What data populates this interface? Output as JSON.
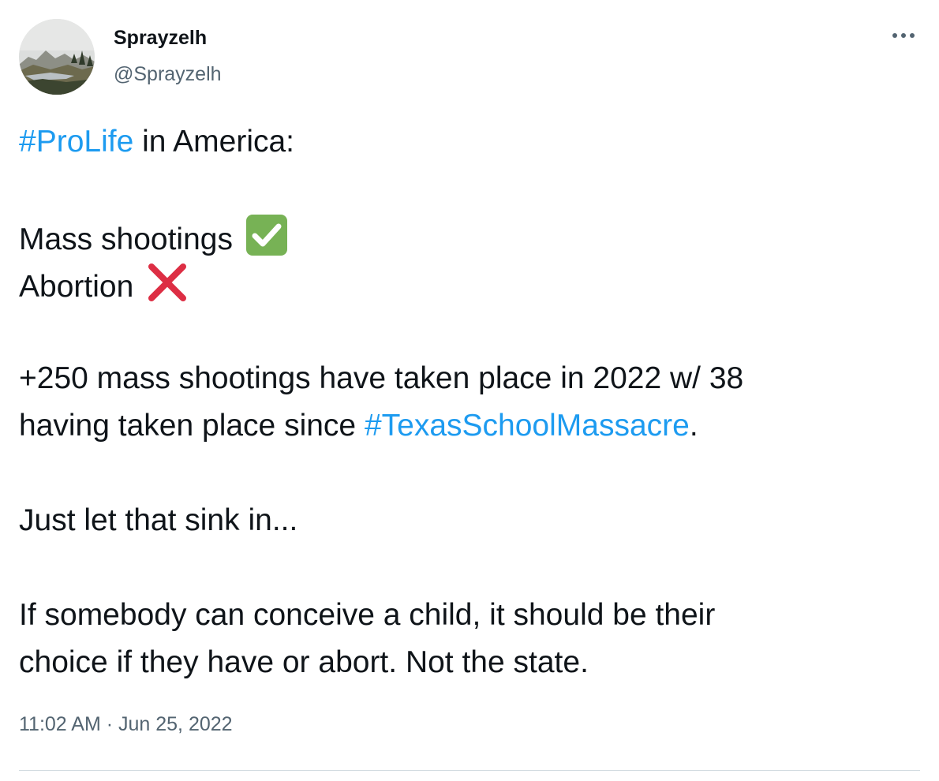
{
  "user": {
    "display_name": "Sprayzelh",
    "handle": "@Sprayzelh",
    "avatar_icon": "landscape-avatar"
  },
  "menu": {
    "more_icon": "more-horizontal-icon"
  },
  "tweet": {
    "l1_hashtag": "#ProLife",
    "l1_text": " in America:",
    "l2_text": "Mass shootings ",
    "l2_emoji": "check-mark-button-emoji",
    "l3_text": "Abortion ",
    "l3_emoji": "cross-mark-emoji",
    "l4_text": "+250 mass shootings have taken place in 2022 w/ 38",
    "l5_text": "having taken place since ",
    "l5_hashtag": "#TexasSchoolMassacre",
    "l5_end": ".",
    "l6_text": "Just let that sink in...",
    "l7_text": "If somebody can conceive a child, it should be their",
    "l8_text": "choice if they have or abort. Not the state."
  },
  "meta": {
    "time": "11:02 AM",
    "separator": " · ",
    "date": "Jun 25, 2022"
  },
  "colors": {
    "text": "#0f1419",
    "secondary": "#536471",
    "link": "#1d9bf0",
    "divider": "#cfd9de",
    "check_green": "#77b255",
    "cross_red": "#dd2e44"
  }
}
